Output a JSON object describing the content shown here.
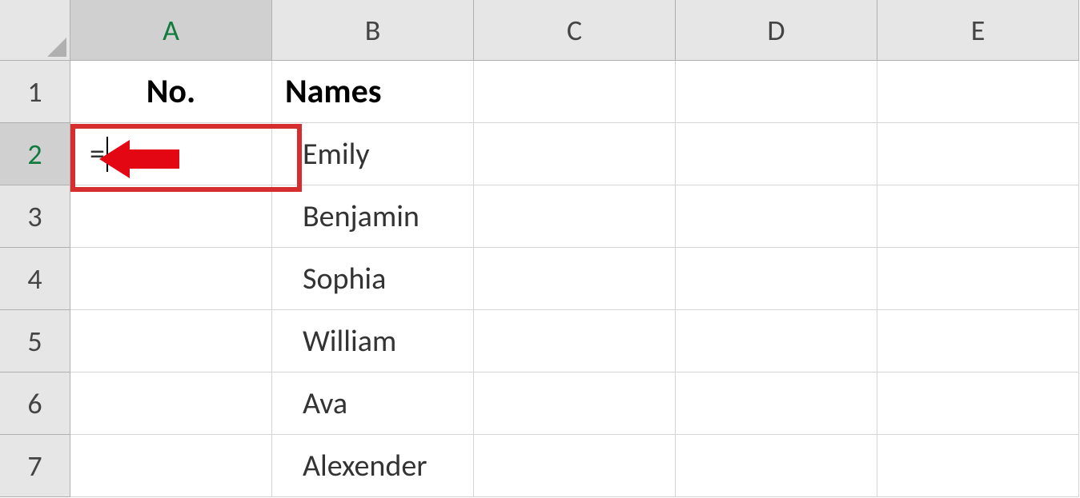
{
  "columns": [
    "A",
    "B",
    "C",
    "D",
    "E"
  ],
  "rows": [
    "1",
    "2",
    "3",
    "4",
    "5",
    "6",
    "7"
  ],
  "active_cell": "A2",
  "active_column": "A",
  "active_row": "2",
  "cells": {
    "A1": "No.",
    "B1": "Names",
    "A2": "=",
    "B2": "Emily",
    "B3": "Benjamin",
    "B4": "Sophia",
    "B5": "William",
    "B6": "Ava",
    "B7": "Alexender"
  },
  "annotation": {
    "type": "arrow",
    "direction": "left",
    "color": "#e30613"
  }
}
